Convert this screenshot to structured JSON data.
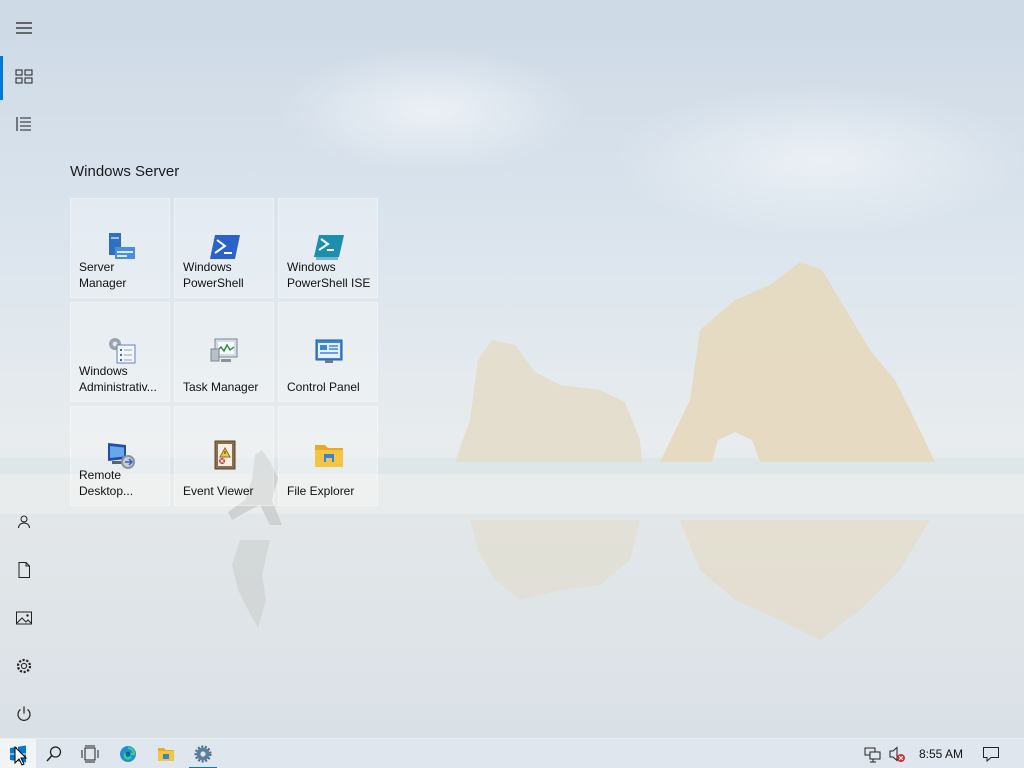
{
  "start_menu": {
    "rail": {
      "expand": "menu-icon",
      "tiles_view": "tiles-icon",
      "all_apps": "list-icon",
      "user": "user-icon",
      "documents": "document-icon",
      "pictures": "pictures-icon",
      "settings": "gear-icon",
      "power": "power-icon"
    },
    "group_title": "Windows Server",
    "tiles": [
      {
        "label": "Server Manager",
        "icon": "server-manager-icon"
      },
      {
        "label": "Windows\nPowerShell",
        "icon": "powershell-icon"
      },
      {
        "label": "Windows\nPowerShell ISE",
        "icon": "powershell-ise-icon"
      },
      {
        "label": "Windows\nAdministrativ...",
        "icon": "admin-tools-icon"
      },
      {
        "label": "Task Manager",
        "icon": "task-manager-icon"
      },
      {
        "label": "Control Panel",
        "icon": "control-panel-icon"
      },
      {
        "label": "Remote\nDesktop...",
        "icon": "remote-desktop-icon"
      },
      {
        "label": "Event Viewer",
        "icon": "event-viewer-icon"
      },
      {
        "label": "File Explorer",
        "icon": "file-explorer-icon"
      }
    ]
  },
  "taskbar": {
    "start": "windows-logo-icon",
    "search": "search-icon",
    "task_view": "task-view-icon",
    "pinned": [
      "edge-icon",
      "file-explorer-icon",
      "server-manager-icon"
    ],
    "tray": {
      "network": "network-icon",
      "volume": "volume-muted-icon",
      "time": "8:55 AM",
      "notifications": "notifications-icon"
    }
  },
  "colors": {
    "accent": "#0078d7",
    "powershell_blue": "#2a62c9",
    "folder_yellow": "#f4c542"
  }
}
